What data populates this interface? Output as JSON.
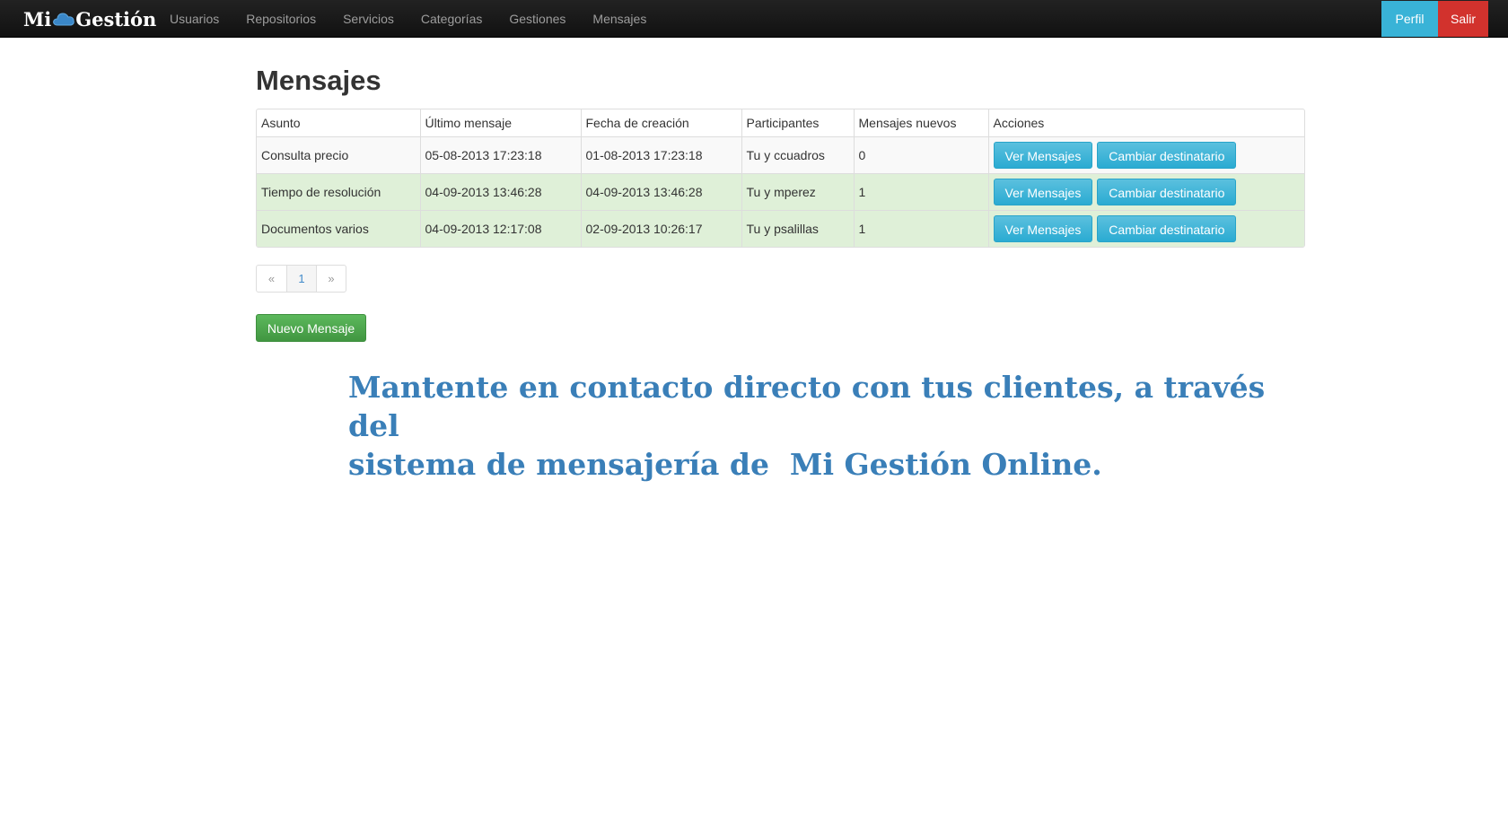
{
  "navbar": {
    "brand_left": "Mi",
    "brand_right": "Gestión",
    "links": [
      "Usuarios",
      "Repositorios",
      "Servicios",
      "Categorías",
      "Gestiones",
      "Mensajes"
    ],
    "perfil_label": "Perfil",
    "salir_label": "Salir"
  },
  "page": {
    "title": "Mensajes"
  },
  "table": {
    "headers": [
      "Asunto",
      "Último mensaje",
      "Fecha de creación",
      "Participantes",
      "Mensajes nuevos",
      "Acciones"
    ],
    "rows": [
      {
        "asunto": "Consulta precio",
        "ultimo": "05-08-2013 17:23:18",
        "creacion": "01-08-2013 17:23:18",
        "participantes": "Tu y ccuadros",
        "nuevos": "0",
        "ver_label": "Ver Mensajes",
        "cambiar_label": "Cambiar destinatario"
      },
      {
        "asunto": "Tiempo de resolución",
        "ultimo": "04-09-2013 13:46:28",
        "creacion": "04-09-2013 13:46:28",
        "participantes": "Tu y mperez",
        "nuevos": "1",
        "ver_label": "Ver Mensajes",
        "cambiar_label": "Cambiar destinatario"
      },
      {
        "asunto": "Documentos varios",
        "ultimo": "04-09-2013 12:17:08",
        "creacion": "02-09-2013 10:26:17",
        "participantes": "Tu y psalillas",
        "nuevos": "1",
        "ver_label": "Ver Mensajes",
        "cambiar_label": "Cambiar destinatario"
      }
    ]
  },
  "pagination": {
    "prev": "«",
    "current": "1",
    "next": "»"
  },
  "new_message_label": "Nuevo Mensaje",
  "promo": {
    "line1": "Mantente en contacto directo con tus clientes, a través del",
    "line2": "sistema de mensajería de  Mi Gestión Online."
  },
  "colors": {
    "navbar": "#1b1b1b",
    "info": "#39b3d7",
    "danger": "#d2322d",
    "success_row": "#dff0d8",
    "success_button": "#47a447",
    "promo_text": "#3a7fb8"
  },
  "icons": {
    "brand_logo": "cloud-icon"
  }
}
